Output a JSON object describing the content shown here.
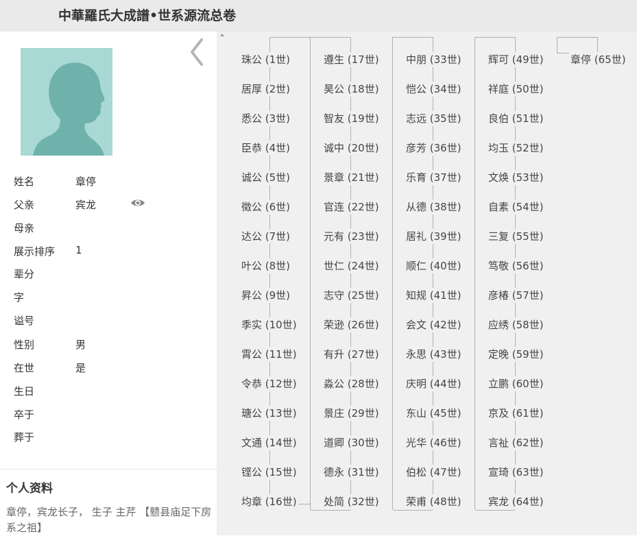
{
  "header": {
    "title": "中華羅氏大成譜•世系源流总卷"
  },
  "person": {
    "fields": [
      {
        "label": "姓名",
        "value": "章停"
      },
      {
        "label": "父亲",
        "value": "宾龙"
      },
      {
        "label": "母亲",
        "value": ""
      },
      {
        "label": "展示排序",
        "value": "1"
      },
      {
        "label": "辈分",
        "value": ""
      },
      {
        "label": "字",
        "value": ""
      },
      {
        "label": "谥号",
        "value": ""
      },
      {
        "label": "性别",
        "value": "男"
      },
      {
        "label": "在世",
        "value": "是"
      },
      {
        "label": "生日",
        "value": ""
      },
      {
        "label": "卒于",
        "value": ""
      },
      {
        "label": "葬于",
        "value": ""
      }
    ]
  },
  "profile": {
    "heading": "个人资料",
    "text": "章停，宾龙长子， 生子 主芹 【戆县庙足下房系之祖】"
  },
  "lineage": {
    "columns": [
      [
        "珠公 (1世)",
        "居厚 (2世)",
        "悉公 (3世)",
        "臣恭 (4世)",
        "诚公 (5世)",
        "徵公 (6世)",
        "达公 (7世)",
        "叶公 (8世)",
        "昇公 (9世)",
        "季实 (10世)",
        "霄公 (11世)",
        "令恭 (12世)",
        "瑭公 (13世)",
        "文通 (14世)",
        "铿公 (15世)",
        "均章 (16世)"
      ],
      [
        "遵生 (17世)",
        "昊公 (18世)",
        "智友 (19世)",
        "诚中 (20世)",
        "景章 (21世)",
        "官连 (22世)",
        "元有 (23世)",
        "世仁 (24世)",
        "志守 (25世)",
        "荣逊 (26世)",
        "有升 (27世)",
        "淼公 (28世)",
        "景庄 (29世)",
        "道卿 (30世)",
        "德永 (31世)",
        "处简 (32世)"
      ],
      [
        "中朋 (33世)",
        "恺公 (34世)",
        "志远 (35世)",
        "彦芳 (36世)",
        "乐育 (37世)",
        "从德 (38世)",
        "居礼 (39世)",
        "顺仁 (40世)",
        "知规 (41世)",
        "会文 (42世)",
        "永思 (43世)",
        "庆明 (44世)",
        "东山 (45世)",
        "光华 (46世)",
        "伯松 (47世)",
        "荣甫 (48世)"
      ],
      [
        "辉可 (49世)",
        "祥庭 (50世)",
        "良伯 (51世)",
        "均玉 (52世)",
        "文焕 (53世)",
        "自素 (54世)",
        "三复 (55世)",
        "笃敬 (56世)",
        "彦椿 (57世)",
        "应绣 (58世)",
        "定晚 (59世)",
        "立鹏 (60世)",
        "京及 (61世)",
        "言祉 (62世)",
        "宣琦 (63世)",
        "宾龙 (64世)"
      ],
      [
        "章停 (65世)"
      ]
    ]
  }
}
